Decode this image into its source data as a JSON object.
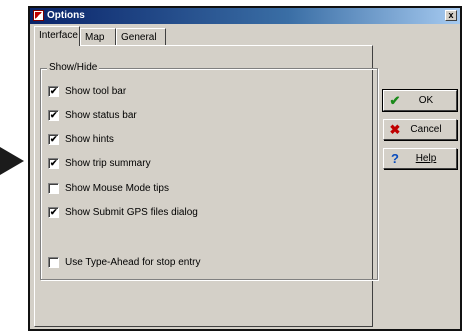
{
  "window": {
    "title": "Options",
    "close_glyph": "x"
  },
  "tabs": [
    {
      "label": "Interface"
    },
    {
      "label": "Map"
    },
    {
      "label": "General"
    }
  ],
  "group": {
    "label": "Show/Hide",
    "checkboxes": [
      {
        "label": "Show tool bar",
        "checked": true
      },
      {
        "label": "Show status bar",
        "checked": true
      },
      {
        "label": "Show hints",
        "checked": true
      },
      {
        "label": "Show trip summary",
        "checked": true
      },
      {
        "label": "Show Mouse Mode tips",
        "checked": false
      },
      {
        "label": "Show Submit GPS files dialog",
        "checked": true
      },
      {
        "label": "Use Type-Ahead for stop entry",
        "checked": false
      }
    ]
  },
  "buttons": {
    "ok": {
      "label": "OK",
      "icon": "checkmark-icon",
      "glyph": "✔"
    },
    "cancel": {
      "label": "Cancel",
      "icon": "x-icon",
      "glyph": "✖"
    },
    "help": {
      "label": "Help",
      "icon": "question-icon",
      "glyph": "?"
    }
  },
  "colors": {
    "titlebar": "#0a246a",
    "dialog_bg": "#d4d0c8"
  }
}
